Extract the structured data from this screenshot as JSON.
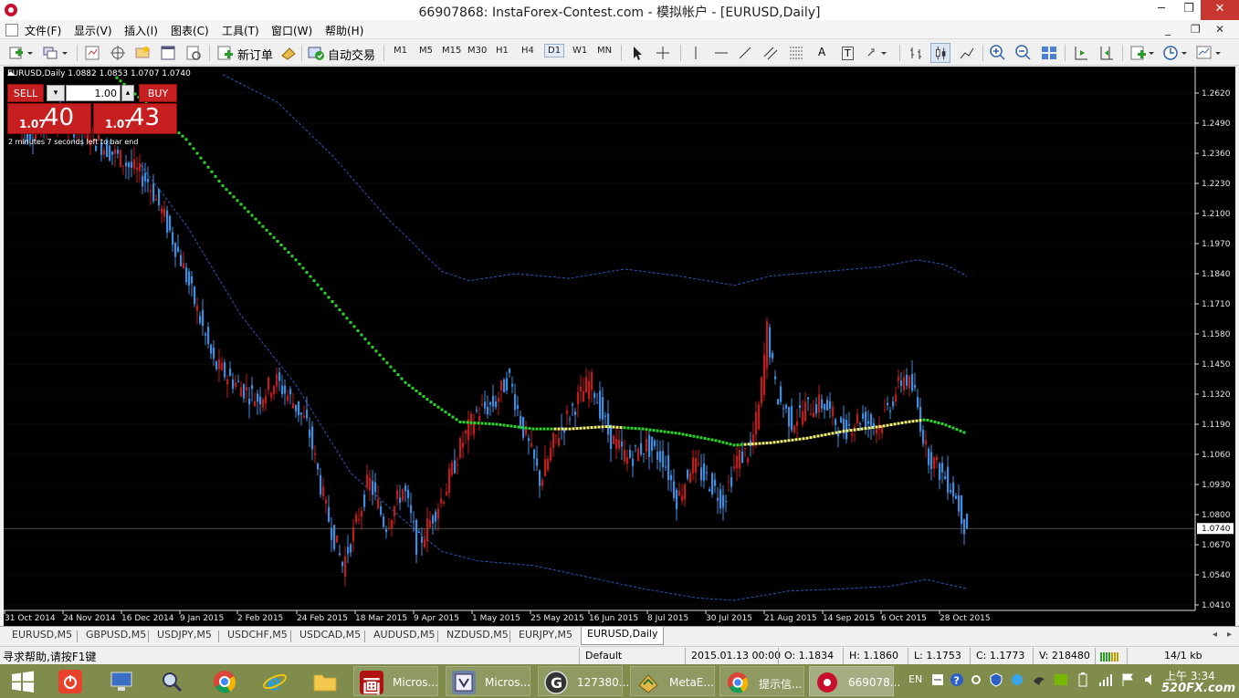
{
  "window": {
    "title": "66907868: InstaForex-Contest.com - 模拟帐户 - [EURUSD,Daily]",
    "min": "─",
    "max": "❐",
    "close": "✕"
  },
  "menu": [
    "文件(F)",
    "显示(V)",
    "插入(I)",
    "图表(C)",
    "工具(T)",
    "窗口(W)",
    "帮助(H)"
  ],
  "mdi": {
    "min": "_",
    "restore": "❐",
    "close": "✕"
  },
  "toolbar": {
    "new_order": "新订单",
    "auto_trading": "自动交易",
    "timeframes": [
      "M1",
      "M5",
      "M15",
      "M30",
      "H1",
      "H4",
      "D1",
      "W1",
      "MN"
    ],
    "active_timeframe": "D1",
    "text_tool": "A",
    "label_tool": "T"
  },
  "chart": {
    "header": "EURUSD,Daily  1.0882 1.0853 1.0707 1.0740",
    "trade_panel": {
      "sell": "SELL",
      "buy": "BUY",
      "lot": "1.00",
      "sell_big": "1.07",
      "sell_pips": "40",
      "buy_big": "1.07",
      "buy_pips": "43",
      "timer": "2 minutes 7 seconds left to bar end"
    },
    "current_price": "1.0740",
    "price_labels": [
      "1.2620",
      "1.2490",
      "1.2360",
      "1.2230",
      "1.2100",
      "1.1970",
      "1.1840",
      "1.1710",
      "1.1580",
      "1.1450",
      "1.1320",
      "1.1190",
      "1.1060",
      "1.0930",
      "1.0800",
      "1.0670",
      "1.0540",
      "1.0410"
    ],
    "date_labels": [
      "31 Oct 2014",
      "24 Nov 2014",
      "16 Dec 2014",
      "9 Jan 2015",
      "2 Feb 2015",
      "24 Feb 2015",
      "18 Mar 2015",
      "9 Apr 2015",
      "1 May 2015",
      "25 May 2015",
      "16 Jun 2015",
      "8 Jul 2015",
      "30 Jul 2015",
      "21 Aug 2015",
      "14 Sep 2015",
      "6 Oct 2015",
      "28 Oct 2015"
    ],
    "colors": {
      "background": "#000000",
      "bull": "#c41a1a",
      "bear": "#3b8fe0",
      "ma": "#2fd42f",
      "ma_flat": "#f2f27a",
      "band": "#2858b8",
      "grid": "#1b1b1b"
    }
  },
  "tabs": [
    "EURUSD,M5",
    "GBPUSD,M5",
    "USDJPY,M5",
    "USDCHF,M5",
    "USDCAD,M5",
    "AUDUSD,M5",
    "NZDUSD,M5",
    "EURJPY,M5",
    "EURUSD,Daily"
  ],
  "active_tab": "EURUSD,Daily",
  "status": {
    "help": "寻求帮助,请按F1键",
    "profile": "Default",
    "datetime": "2015.01.13 00:00",
    "open": "O: 1.1834",
    "high": "H: 1.1860",
    "low": "L: 1.1753",
    "close": "C: 1.1773",
    "volume": "V: 218480",
    "traffic": "14/1 kb"
  },
  "taskbar": {
    "apps": [
      "Micros...",
      "Micros...",
      "127380...",
      "MetaE...",
      "提示信...",
      "669078..."
    ],
    "lang": "EN",
    "clock_period": "上午 3:34",
    "watermark": "520FX.com"
  }
}
